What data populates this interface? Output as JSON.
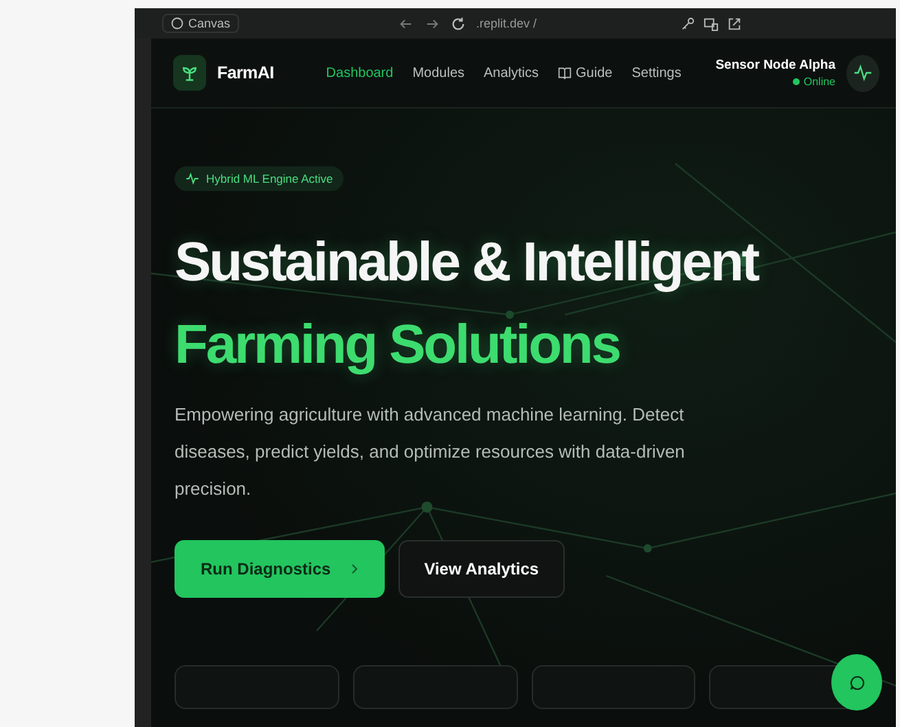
{
  "browser": {
    "tab": "Canvas",
    "url": ".replit.dev /"
  },
  "nav": {
    "brand": "FarmAI",
    "links": [
      {
        "label": "Dashboard",
        "selected": true,
        "kind": "text"
      },
      {
        "label": "Modules",
        "selected": false,
        "kind": "text"
      },
      {
        "label": "Analytics",
        "selected": false,
        "kind": "text"
      },
      {
        "label": "Guide",
        "selected": false,
        "kind": "book"
      },
      {
        "label": "Settings",
        "selected": false,
        "kind": "text"
      }
    ]
  },
  "node": {
    "name": "Sensor Node Alpha",
    "status": "Online",
    "online": true
  },
  "hero": {
    "badge": "Hybrid ML Engine Active",
    "title_lines": [
      {
        "text": "Sustainable & Intelligent",
        "accent": false
      },
      {
        "text": "Farming Solutions",
        "accent": true
      }
    ],
    "description": "Empowering agriculture with advanced machine learning. Detect diseases, predict yields, and optimize resources with data-driven precision.",
    "buttons": [
      {
        "label": "Run Diagnostics",
        "kind": "primary"
      },
      {
        "label": "View Analytics",
        "kind": "secondary"
      }
    ]
  }
}
